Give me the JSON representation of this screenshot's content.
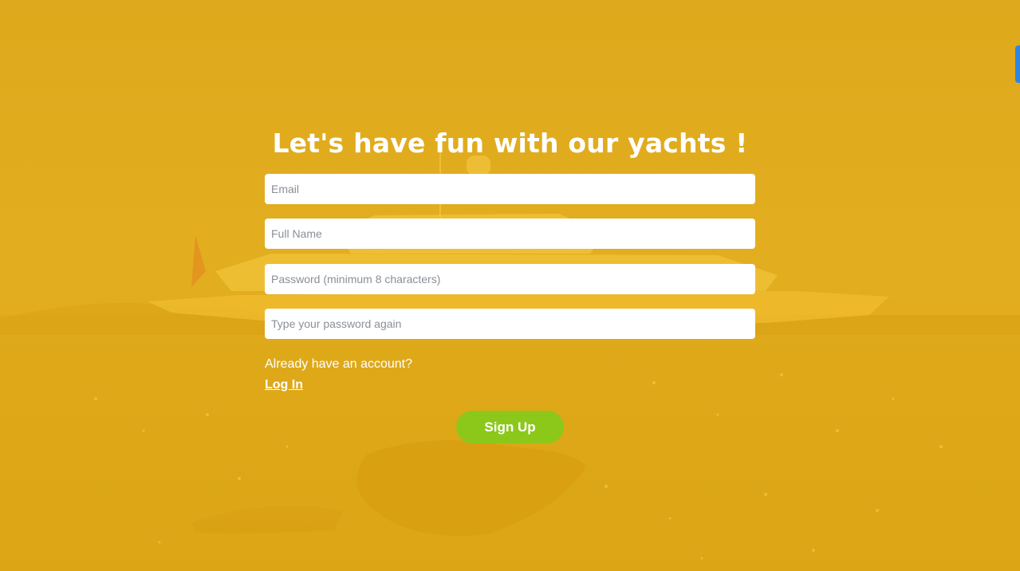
{
  "page": {
    "title": "Let's have fun with our yachts !"
  },
  "form": {
    "email_placeholder": "Email",
    "fullname_placeholder": "Full Name",
    "password_placeholder": "Password (minimum 8 characters)",
    "confirm_placeholder": "Type your password again"
  },
  "account": {
    "prompt": "Already have an account?",
    "login_label": "Log In"
  },
  "actions": {
    "signup_label": "Sign Up"
  },
  "colors": {
    "overlay": "#E0AB1E",
    "button": "#8CC81A",
    "side_tab": "#2F86E0"
  }
}
